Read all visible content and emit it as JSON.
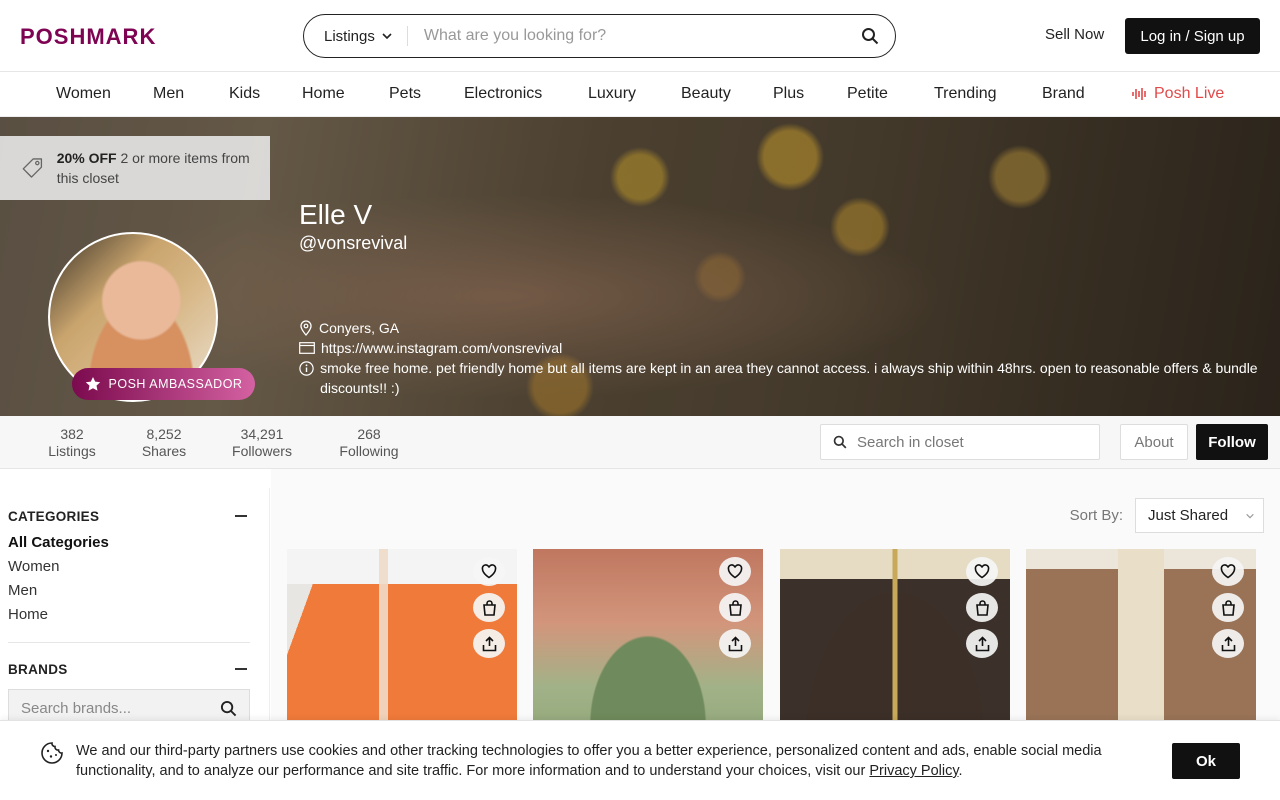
{
  "brand": {
    "logo": "POSHMARK",
    "color": "#7f0353"
  },
  "header": {
    "search_scope": "Listings",
    "search_placeholder": "What are you looking for?",
    "sell_now": "Sell Now",
    "login": "Log in / Sign up"
  },
  "nav": {
    "items": [
      "Women",
      "Men",
      "Kids",
      "Home",
      "Pets",
      "Electronics",
      "Luxury",
      "Beauty",
      "Plus",
      "Petite",
      "Trending",
      "Brand"
    ],
    "live": "Posh Live"
  },
  "profile": {
    "promo_bold": "20% OFF",
    "promo_rest": " 2 or more items from this closet",
    "name": "Elle V",
    "handle": "@vonsrevival",
    "ambassador": "POSH AMBASSADOR",
    "location": "Conyers, GA",
    "website": "https://www.instagram.com/vonsrevival",
    "bio": "smoke free home. pet friendly home but all items are kept in an area they cannot access. i always ship within 48hrs. open to reasonable offers & bundle discounts!! :)"
  },
  "stats": [
    {
      "value": "382",
      "label": "Listings"
    },
    {
      "value": "8,252",
      "label": "Shares"
    },
    {
      "value": "34,291",
      "label": "Followers"
    },
    {
      "value": "268",
      "label": "Following"
    }
  ],
  "closet": {
    "search_placeholder": "Search in closet",
    "about": "About",
    "follow": "Follow"
  },
  "sidebar": {
    "categories_title": "CATEGORIES",
    "categories": [
      "All Categories",
      "Women",
      "Men",
      "Home"
    ],
    "brands_title": "BRANDS",
    "brand_search_placeholder": "Search brands..."
  },
  "sort": {
    "label": "Sort By:",
    "value": "Just Shared"
  },
  "cookie": {
    "text": "We and our third-party partners use cookies and other tracking technologies to offer you a better experience, personalized content and ads, enable social media functionality, and to analyze our performance and site traffic. For more information and to understand your choices, visit our ",
    "link": "Privacy Policy",
    "tail": ".",
    "ok": "Ok"
  }
}
